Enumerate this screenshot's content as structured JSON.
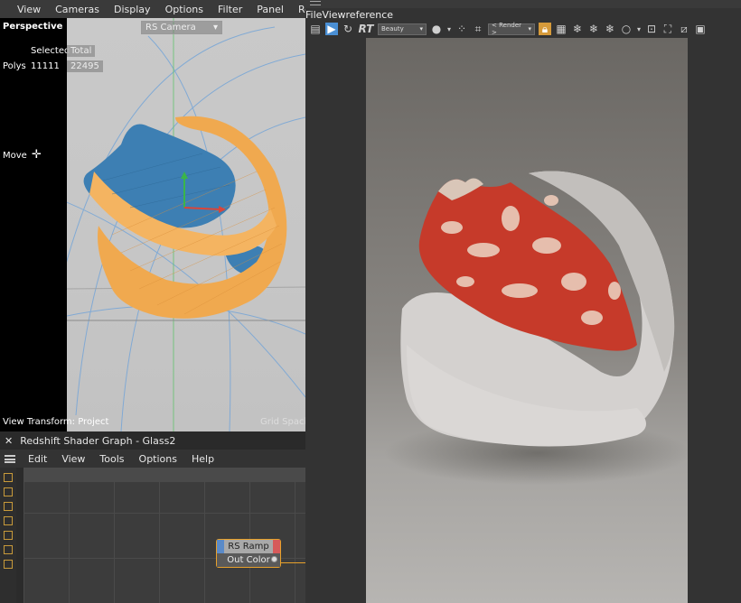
{
  "viewport": {
    "menu": [
      "View",
      "Cameras",
      "Display",
      "Options",
      "Filter",
      "Panel",
      "Redshift"
    ],
    "mode": "Perspective",
    "camera_dropdown": "RS Camera",
    "stats": {
      "header_selected": "Selected",
      "header_total": "Total",
      "row_label": "Polys",
      "selected_value": "11111",
      "total_value": "22495"
    },
    "tool_label": "Move",
    "bottom_left": "View Transform: Project",
    "bottom_right": "Grid Spacing"
  },
  "render_view": {
    "menu": [
      "File",
      "View",
      "reference"
    ],
    "toolbar": {
      "rt_label": "RT",
      "aov_dropdown": "Beauty",
      "render_dropdown": "< Render >"
    },
    "icons": [
      "hamburger-icon",
      "clapper-icon",
      "play-icon",
      "refresh-icon",
      "rt-icon",
      "dropdown",
      "color-ball-icon",
      "grid-dots-icon",
      "crop-icon",
      "dropdown",
      "lock-icon",
      "grid-icon",
      "snowflake-icon",
      "snowflake-icon",
      "snowflake-icon",
      "circle-icon",
      "fit-icon",
      "expand-icon",
      "compare-icon",
      "image-icon"
    ]
  },
  "shader_graph": {
    "title": "Redshift Shader Graph - Glass2",
    "menu": [
      "Edit",
      "View",
      "Tools",
      "Options",
      "Help"
    ],
    "node": {
      "title": "RS Ramp",
      "port": "Out Color"
    }
  },
  "colors": {
    "accent_orange": "#e8a12b",
    "mesh_orange": "#f0a94f",
    "mesh_blue": "#3d7fb3",
    "render_red": "#c63a2a"
  }
}
